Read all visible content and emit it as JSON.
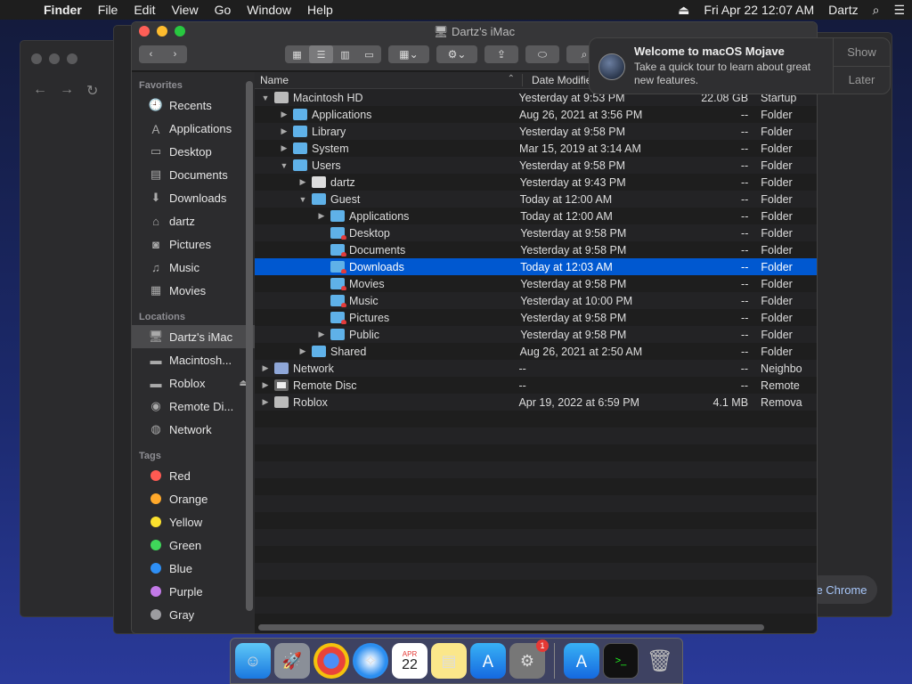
{
  "menubar": {
    "items": [
      "Finder",
      "File",
      "Edit",
      "View",
      "Go",
      "Window",
      "Help"
    ],
    "clock": "Fri Apr 22  12:07 AM",
    "user": "Dartz"
  },
  "window": {
    "title": "Dartz's iMac"
  },
  "sidebar": {
    "favorites_label": "Favorites",
    "favorites": [
      "Recents",
      "Applications",
      "Desktop",
      "Documents",
      "Downloads",
      "dartz",
      "Pictures",
      "Music",
      "Movies"
    ],
    "locations_label": "Locations",
    "locations": [
      "Dartz's iMac",
      "Macintosh...",
      "Roblox",
      "Remote Di...",
      "Network"
    ],
    "tags_label": "Tags",
    "tags": [
      {
        "name": "Red",
        "color": "#ff5a52"
      },
      {
        "name": "Orange",
        "color": "#ffa92b"
      },
      {
        "name": "Yellow",
        "color": "#fbe12e"
      },
      {
        "name": "Green",
        "color": "#3fd65a"
      },
      {
        "name": "Blue",
        "color": "#2e8ff5"
      },
      {
        "name": "Purple",
        "color": "#c37ae8"
      },
      {
        "name": "Gray",
        "color": "#9c9ca0"
      }
    ]
  },
  "list": {
    "col_name": "Name",
    "col_date": "Date Modifie",
    "rows": [
      {
        "name": "Macintosh HD",
        "date": "Yesterday at 9:53 PM",
        "size": "22.08 GB",
        "kind": "Startup"
      },
      {
        "name": "Applications",
        "date": "Aug 26, 2021 at 3:56 PM",
        "size": "--",
        "kind": "Folder"
      },
      {
        "name": "Library",
        "date": "Yesterday at 9:58 PM",
        "size": "--",
        "kind": "Folder"
      },
      {
        "name": "System",
        "date": "Mar 15, 2019 at 3:14 AM",
        "size": "--",
        "kind": "Folder"
      },
      {
        "name": "Users",
        "date": "Yesterday at 9:58 PM",
        "size": "--",
        "kind": "Folder"
      },
      {
        "name": "dartz",
        "date": "Yesterday at 9:43 PM",
        "size": "--",
        "kind": "Folder"
      },
      {
        "name": "Guest",
        "date": "Today at 12:00 AM",
        "size": "--",
        "kind": "Folder"
      },
      {
        "name": "Applications",
        "date": "Today at 12:00 AM",
        "size": "--",
        "kind": "Folder"
      },
      {
        "name": "Desktop",
        "date": "Yesterday at 9:58 PM",
        "size": "--",
        "kind": "Folder"
      },
      {
        "name": "Documents",
        "date": "Yesterday at 9:58 PM",
        "size": "--",
        "kind": "Folder"
      },
      {
        "name": "Downloads",
        "date": "Today at 12:03 AM",
        "size": "--",
        "kind": "Folder"
      },
      {
        "name": "Movies",
        "date": "Yesterday at 9:58 PM",
        "size": "--",
        "kind": "Folder"
      },
      {
        "name": "Music",
        "date": "Yesterday at 10:00 PM",
        "size": "--",
        "kind": "Folder"
      },
      {
        "name": "Pictures",
        "date": "Yesterday at 9:58 PM",
        "size": "--",
        "kind": "Folder"
      },
      {
        "name": "Public",
        "date": "Yesterday at 9:58 PM",
        "size": "--",
        "kind": "Folder"
      },
      {
        "name": "Shared",
        "date": "Aug 26, 2021 at 2:50 AM",
        "size": "--",
        "kind": "Folder"
      },
      {
        "name": "Network",
        "date": "--",
        "size": "--",
        "kind": "Neighbo"
      },
      {
        "name": "Remote Disc",
        "date": "--",
        "size": "--",
        "kind": "Remote"
      },
      {
        "name": "Roblox",
        "date": "Apr 19, 2022 at 6:59 PM",
        "size": "4.1 MB",
        "kind": "Remova"
      }
    ]
  },
  "notification": {
    "title": "Welcome to macOS Mojave",
    "body": "Take a quick tour to learn about great new features.",
    "show": "Show",
    "later": "Later"
  },
  "chrome_pill": "e Chrome",
  "dock": {
    "calendar_month": "APR",
    "calendar_day": "22",
    "badge": "1"
  }
}
